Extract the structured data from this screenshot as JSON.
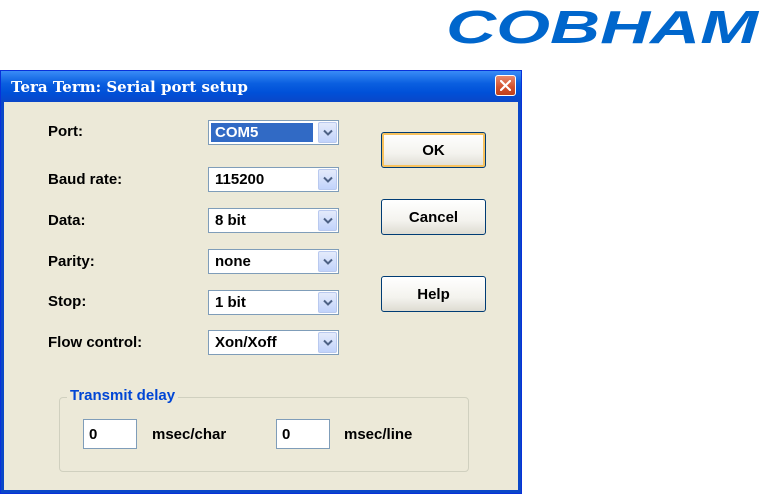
{
  "brand": {
    "logo_text": "COBHAM",
    "color": "#0066cc"
  },
  "dialog": {
    "title": "Tera Term: Serial port setup",
    "close_icon": "close-icon",
    "fields": {
      "port": {
        "label": "Port:",
        "value": "COM5"
      },
      "baud_rate": {
        "label": "Baud rate:",
        "value": "115200"
      },
      "data": {
        "label": "Data:",
        "value": "8 bit"
      },
      "parity": {
        "label": "Parity:",
        "value": "none"
      },
      "stop": {
        "label": "Stop:",
        "value": "1 bit"
      },
      "flow_control": {
        "label": "Flow control:",
        "value": "Xon/Xoff"
      }
    },
    "buttons": {
      "ok": "OK",
      "cancel": "Cancel",
      "help": "Help"
    },
    "transmit_delay": {
      "title": "Transmit delay",
      "char_value": "0",
      "char_unit": "msec/char",
      "line_value": "0",
      "line_unit": "msec/line"
    }
  },
  "colors": {
    "titlebar": "#0a5fe0",
    "dialog_bg": "#ece9d8",
    "selection": "#316ac5",
    "group_title": "#0046d5"
  }
}
